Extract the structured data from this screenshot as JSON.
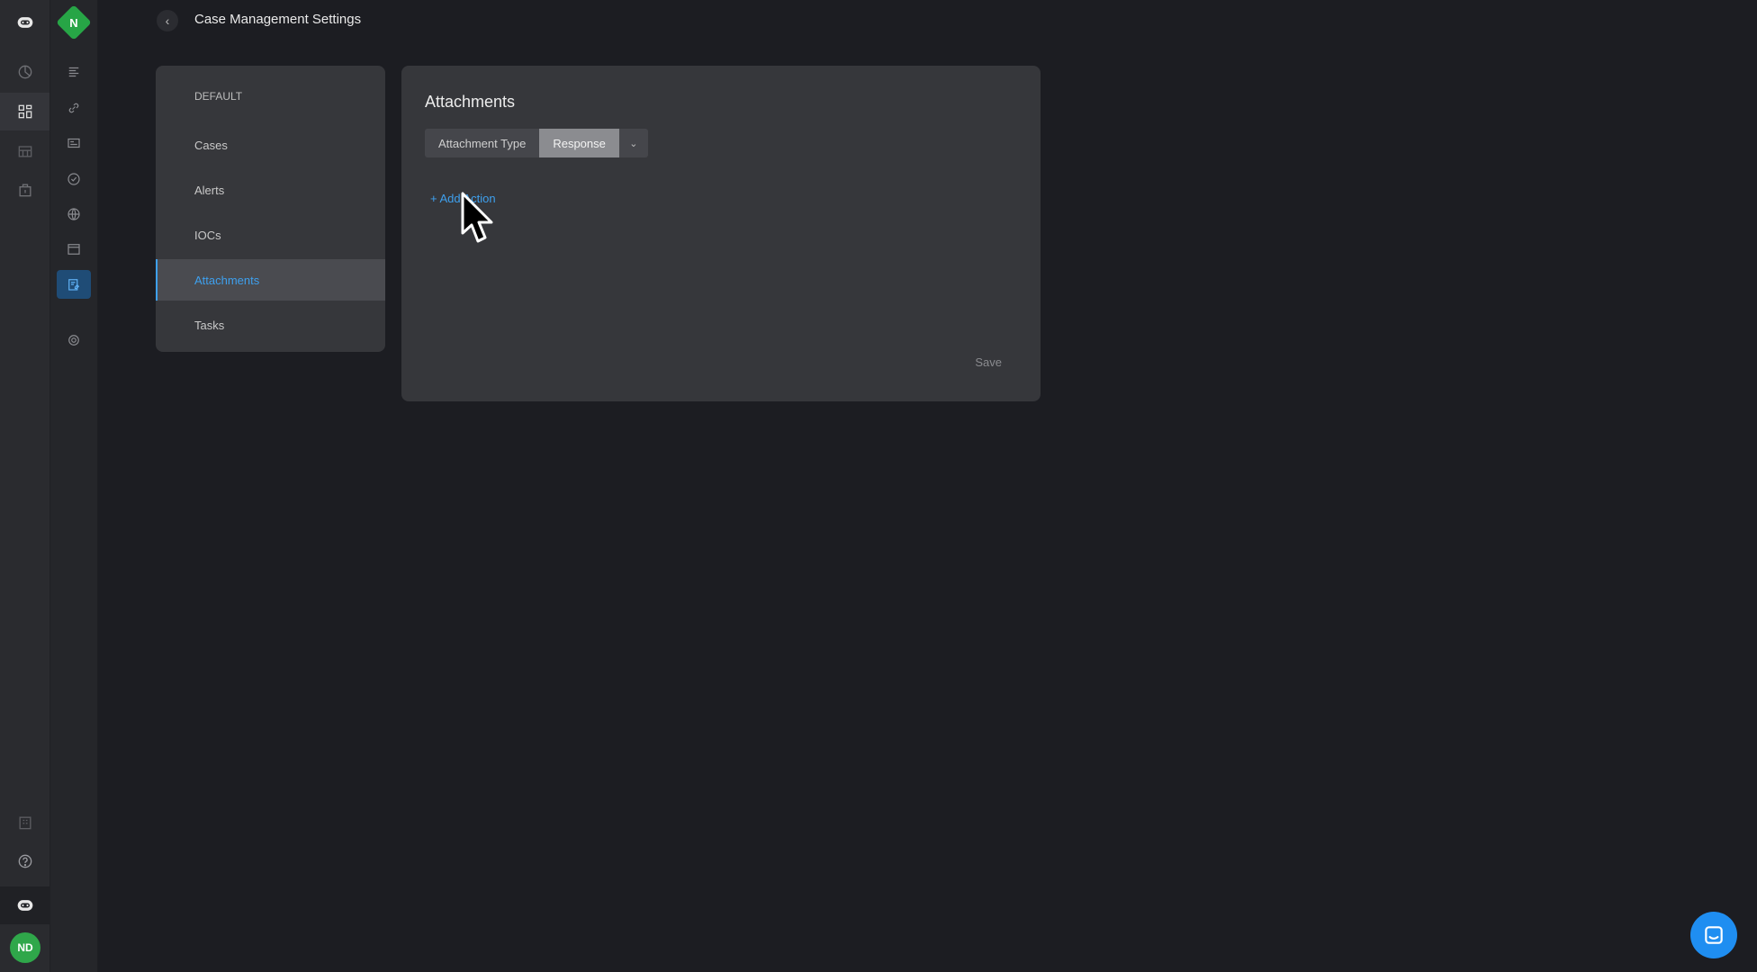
{
  "header": {
    "title": "Case Management Settings",
    "back_icon": "chevron-left-icon",
    "org_badge": "N"
  },
  "settings_nav": {
    "items": [
      {
        "label": "DEFAULT",
        "active": false
      },
      {
        "label": "Cases",
        "active": false
      },
      {
        "label": "Alerts",
        "active": false
      },
      {
        "label": "IOCs",
        "active": false
      },
      {
        "label": "Attachments",
        "active": true
      },
      {
        "label": "Tasks",
        "active": false
      }
    ]
  },
  "main": {
    "title": "Attachments",
    "selector_label": "Attachment Type",
    "selector_value": "Response",
    "add_action_label": "+ Add Action",
    "save_label": "Save"
  },
  "user": {
    "initials": "ND"
  },
  "colors": {
    "accent": "#3ea0ee",
    "brand_green": "#27a546",
    "panel": "#36373b",
    "background": "#1c1d22"
  }
}
